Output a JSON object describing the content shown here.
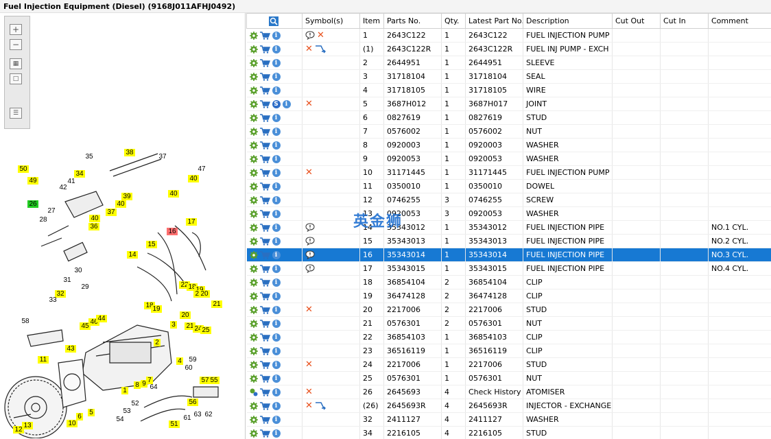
{
  "window": {
    "title": "Fuel Injection Equipment (Diesel) (9168J011AFHJ0492)"
  },
  "watermark": "英金狮",
  "columns": {
    "symbols": "Symbol(s)",
    "item": "Item",
    "parts_no": "Parts No.",
    "qty": "Qty.",
    "latest": "Latest Part No.",
    "description": "Description",
    "cut_out": "Cut Out",
    "cut_in": "Cut In",
    "comment": "Comment"
  },
  "colors": {
    "selection": "#1779d3",
    "callout_yellow": "#ffff00",
    "callout_green": "#22cc22",
    "callout_red": "#ff7070"
  },
  "rows": [
    {
      "sym": [
        "comment",
        "x"
      ],
      "item": "1",
      "part": "2643C122",
      "qty": "1",
      "latest": "2643C122",
      "desc": "FUEL INJECTION PUMP",
      "comment": ""
    },
    {
      "sym": [
        "x",
        "exchange"
      ],
      "item": "(1)",
      "part": "2643C122R",
      "qty": "1",
      "latest": "2643C122R",
      "desc": "FUEL INJ PUMP - EXCH",
      "comment": ""
    },
    {
      "sym": [],
      "item": "2",
      "part": "2644951",
      "qty": "1",
      "latest": "2644951",
      "desc": "SLEEVE",
      "comment": ""
    },
    {
      "sym": [],
      "item": "3",
      "part": "31718104",
      "qty": "1",
      "latest": "31718104",
      "desc": "SEAL",
      "comment": ""
    },
    {
      "sym": [],
      "item": "4",
      "part": "31718105",
      "qty": "1",
      "latest": "31718105",
      "desc": "WIRE",
      "comment": ""
    },
    {
      "sym": [
        "x"
      ],
      "item": "5",
      "part": "3687H012",
      "qty": "1",
      "latest": "3687H017",
      "desc": "JOINT",
      "comment": "",
      "s": true
    },
    {
      "sym": [],
      "item": "6",
      "part": "0827619",
      "qty": "1",
      "latest": "0827619",
      "desc": "STUD",
      "comment": ""
    },
    {
      "sym": [],
      "item": "7",
      "part": "0576002",
      "qty": "1",
      "latest": "0576002",
      "desc": "NUT",
      "comment": ""
    },
    {
      "sym": [],
      "item": "8",
      "part": "0920003",
      "qty": "1",
      "latest": "0920003",
      "desc": "WASHER",
      "comment": ""
    },
    {
      "sym": [],
      "item": "9",
      "part": "0920053",
      "qty": "1",
      "latest": "0920053",
      "desc": "WASHER",
      "comment": ""
    },
    {
      "sym": [
        "x"
      ],
      "item": "10",
      "part": "31171445",
      "qty": "1",
      "latest": "31171445",
      "desc": "FUEL INJECTION PUMP G",
      "comment": ""
    },
    {
      "sym": [],
      "item": "11",
      "part": "0350010",
      "qty": "1",
      "latest": "0350010",
      "desc": "DOWEL",
      "comment": ""
    },
    {
      "sym": [],
      "item": "12",
      "part": "0746255",
      "qty": "3",
      "latest": "0746255",
      "desc": "SCREW",
      "comment": ""
    },
    {
      "sym": [],
      "item": "13",
      "part": "0920053",
      "qty": "3",
      "latest": "0920053",
      "desc": "WASHER",
      "comment": ""
    },
    {
      "sym": [
        "comment"
      ],
      "item": "14",
      "part": "35343012",
      "qty": "1",
      "latest": "35343012",
      "desc": "FUEL INJECTION PIPE",
      "comment": "NO.1 CYL."
    },
    {
      "sym": [
        "comment"
      ],
      "item": "15",
      "part": "35343013",
      "qty": "1",
      "latest": "35343013",
      "desc": "FUEL INJECTION PIPE",
      "comment": "NO.2 CYL."
    },
    {
      "sym": [
        "comment"
      ],
      "item": "16",
      "part": "35343014",
      "qty": "1",
      "latest": "35343014",
      "desc": "FUEL INJECTION PIPE",
      "comment": "NO.3 CYL.",
      "selected": true
    },
    {
      "sym": [
        "comment"
      ],
      "item": "17",
      "part": "35343015",
      "qty": "1",
      "latest": "35343015",
      "desc": "FUEL INJECTION PIPE",
      "comment": "NO.4 CYL."
    },
    {
      "sym": [],
      "item": "18",
      "part": "36854104",
      "qty": "2",
      "latest": "36854104",
      "desc": "CLIP",
      "comment": ""
    },
    {
      "sym": [],
      "item": "19",
      "part": "36474128",
      "qty": "2",
      "latest": "36474128",
      "desc": "CLIP",
      "comment": ""
    },
    {
      "sym": [
        "x"
      ],
      "item": "20",
      "part": "2217006",
      "qty": "2",
      "latest": "2217006",
      "desc": "STUD",
      "comment": ""
    },
    {
      "sym": [],
      "item": "21",
      "part": "0576301",
      "qty": "2",
      "latest": "0576301",
      "desc": "NUT",
      "comment": ""
    },
    {
      "sym": [],
      "item": "22",
      "part": "36854103",
      "qty": "1",
      "latest": "36854103",
      "desc": "CLIP",
      "comment": ""
    },
    {
      "sym": [],
      "item": "23",
      "part": "36516119",
      "qty": "1",
      "latest": "36516119",
      "desc": "CLIP",
      "comment": ""
    },
    {
      "sym": [
        "x"
      ],
      "item": "24",
      "part": "2217006",
      "qty": "1",
      "latest": "2217006",
      "desc": "STUD",
      "comment": ""
    },
    {
      "sym": [],
      "item": "25",
      "part": "0576301",
      "qty": "1",
      "latest": "0576301",
      "desc": "NUT",
      "comment": ""
    },
    {
      "sym": [
        "x"
      ],
      "item": "26",
      "part": "2645693",
      "qty": "4",
      "latest": "Check History",
      "desc": "ATOMISER",
      "comment": "",
      "multi": true
    },
    {
      "sym": [
        "x",
        "exchange"
      ],
      "item": "(26)",
      "part": "2645693R",
      "qty": "4",
      "latest": "2645693R",
      "desc": "INJECTOR - EXCHANGE",
      "comment": ""
    },
    {
      "sym": [],
      "item": "32",
      "part": "2411127",
      "qty": "4",
      "latest": "2411127",
      "desc": "WASHER",
      "comment": ""
    },
    {
      "sym": [],
      "item": "34",
      "part": "2216105",
      "qty": "4",
      "latest": "2216105",
      "desc": "STUD",
      "comment": ""
    }
  ],
  "callouts": [
    {
      "t": "38",
      "c": "y"
    },
    {
      "t": "35",
      "c": "n"
    },
    {
      "t": "37",
      "c": "n"
    },
    {
      "t": "47",
      "c": "n"
    },
    {
      "t": "50",
      "c": "y"
    },
    {
      "t": "49",
      "c": "y"
    },
    {
      "t": "34",
      "c": "y"
    },
    {
      "t": "41",
      "c": "n"
    },
    {
      "t": "42",
      "c": "n"
    },
    {
      "t": "39",
      "c": "y"
    },
    {
      "t": "40",
      "c": "y"
    },
    {
      "t": "40",
      "c": "y"
    },
    {
      "t": "40",
      "c": "y"
    },
    {
      "t": "26",
      "c": "g"
    },
    {
      "t": "27",
      "c": "n"
    },
    {
      "t": "28",
      "c": "n"
    },
    {
      "t": "37",
      "c": "y"
    },
    {
      "t": "40",
      "c": "y"
    },
    {
      "t": "36",
      "c": "y"
    },
    {
      "t": "17",
      "c": "y"
    },
    {
      "t": "16",
      "c": "r"
    },
    {
      "t": "15",
      "c": "y"
    },
    {
      "t": "14",
      "c": "y"
    },
    {
      "t": "30",
      "c": "n"
    },
    {
      "t": "31",
      "c": "n"
    },
    {
      "t": "29",
      "c": "n"
    },
    {
      "t": "32",
      "c": "y"
    },
    {
      "t": "33",
      "c": "n"
    },
    {
      "t": "22",
      "c": "y"
    },
    {
      "t": "18",
      "c": "y"
    },
    {
      "t": "19",
      "c": "y"
    },
    {
      "t": "23",
      "c": "y"
    },
    {
      "t": "20",
      "c": "y"
    },
    {
      "t": "21",
      "c": "y"
    },
    {
      "t": "18",
      "c": "y"
    },
    {
      "t": "19",
      "c": "y"
    },
    {
      "t": "20",
      "c": "y"
    },
    {
      "t": "3",
      "c": "y"
    },
    {
      "t": "21",
      "c": "y"
    },
    {
      "t": "24",
      "c": "y"
    },
    {
      "t": "25",
      "c": "y"
    },
    {
      "t": "58",
      "c": "n"
    },
    {
      "t": "46",
      "c": "y"
    },
    {
      "t": "44",
      "c": "y"
    },
    {
      "t": "45",
      "c": "y"
    },
    {
      "t": "43",
      "c": "y"
    },
    {
      "t": "2",
      "c": "y"
    },
    {
      "t": "4",
      "c": "y"
    },
    {
      "t": "11",
      "c": "y"
    },
    {
      "t": "59",
      "c": "n"
    },
    {
      "t": "60",
      "c": "n"
    },
    {
      "t": "57",
      "c": "y"
    },
    {
      "t": "55",
      "c": "y"
    },
    {
      "t": "8",
      "c": "y"
    },
    {
      "t": "9",
      "c": "y"
    },
    {
      "t": "7",
      "c": "y"
    },
    {
      "t": "64",
      "c": "n"
    },
    {
      "t": "1",
      "c": "y"
    },
    {
      "t": "56",
      "c": "y"
    },
    {
      "t": "5",
      "c": "y"
    },
    {
      "t": "6",
      "c": "y"
    },
    {
      "t": "52",
      "c": "n"
    },
    {
      "t": "53",
      "c": "n"
    },
    {
      "t": "61",
      "c": "n"
    },
    {
      "t": "63",
      "c": "n"
    },
    {
      "t": "62",
      "c": "n"
    },
    {
      "t": "10",
      "c": "y"
    },
    {
      "t": "12",
      "c": "y"
    },
    {
      "t": "13",
      "c": "y"
    },
    {
      "t": "54",
      "c": "n"
    },
    {
      "t": "51",
      "c": "y"
    }
  ]
}
